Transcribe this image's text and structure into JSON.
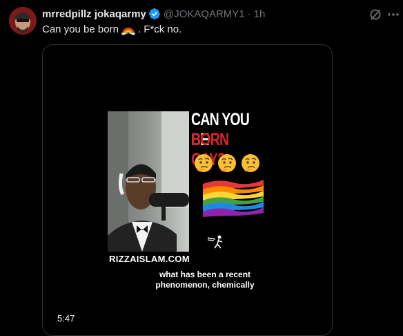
{
  "post": {
    "display_name": "mrredpillz jokaqarmy",
    "handle": "@JOKAQARMY1",
    "separator": "·",
    "time": "1h",
    "text_before": "Can you be born",
    "text_after": ". F*ck no.",
    "emoji": "rainbow-emoji"
  },
  "video": {
    "headline_line1": "CAN YOU BE",
    "headline_line2": "BORN GAY?",
    "watermark": "RIZZAISLAM.COM",
    "caption_line1": "what has been a recent",
    "caption_line2": "phenomenon, chemically",
    "duration": "5:47"
  },
  "icons": {
    "verified": "verified-badge-icon",
    "grok": "grok-icon",
    "more": "more-icon"
  },
  "colors": {
    "background": "#000000",
    "text": "#e7e9ea",
    "muted": "#71767b",
    "verified": "#1d9bf0",
    "headline_red": "#d8232a"
  }
}
